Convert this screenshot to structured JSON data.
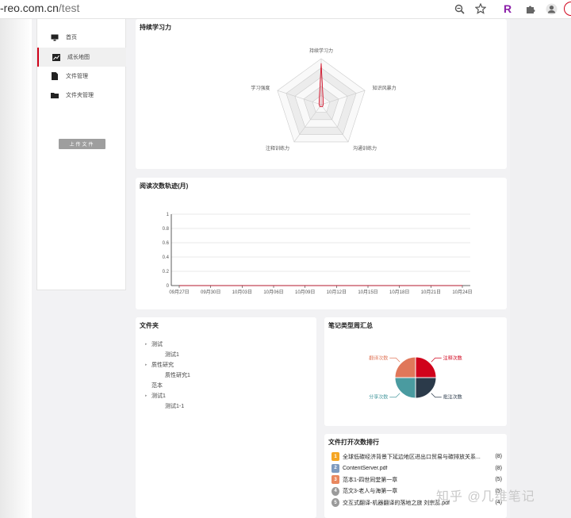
{
  "browser": {
    "url_prefix": "-reo.com.cn",
    "url_path": "/test"
  },
  "sidebar": {
    "items": [
      {
        "label": "首页",
        "icon": "monitor-icon",
        "active": false
      },
      {
        "label": "成长地图",
        "icon": "chart-icon",
        "active": true
      },
      {
        "label": "文件管理",
        "icon": "document-icon",
        "active": false
      },
      {
        "label": "文件夹管理",
        "icon": "folder-icon",
        "active": false
      }
    ],
    "upload_label": "上传文件"
  },
  "radar": {
    "title": "持续学习力",
    "chart_data": {
      "type": "radar",
      "axes": [
        "持续学习力",
        "知识风暴力",
        "沟通训练力",
        "注释训练力",
        "学习强度"
      ],
      "values": [
        0.9,
        0.05,
        0.05,
        0.05,
        0.05
      ],
      "levels": 5
    }
  },
  "reading": {
    "title": "阅读次数轨迹(月)",
    "chart_data": {
      "type": "line",
      "x": [
        "09月27日",
        "09月30日",
        "10月03日",
        "10月06日",
        "10月09日",
        "10月12日",
        "10月15日",
        "10月18日",
        "10月21日",
        "10月24日"
      ],
      "series": [
        {
          "values": [
            0,
            0,
            0,
            0,
            0,
            0,
            0,
            0,
            0,
            0
          ]
        }
      ],
      "yticks": [
        "0",
        "0.2",
        "0.4",
        "0.6",
        "0.8",
        "1"
      ],
      "ylim": [
        0,
        1
      ],
      "grid": true
    }
  },
  "folders": {
    "title": "文件夹",
    "items": [
      {
        "label": "测试",
        "level": 0,
        "caret": "▸"
      },
      {
        "label": "测试1",
        "level": 1,
        "caret": ""
      },
      {
        "label": "质性研究",
        "level": 0,
        "caret": "▸"
      },
      {
        "label": "质性研究1",
        "level": 1,
        "caret": ""
      },
      {
        "label": "范本",
        "level": 0,
        "caret": ""
      },
      {
        "label": "测试1",
        "level": 0,
        "caret": "▸"
      },
      {
        "label": "测试1-1",
        "level": 1,
        "caret": ""
      }
    ]
  },
  "notes": {
    "title": "笔记类型周汇总",
    "chart_data": {
      "type": "pie",
      "slices": [
        {
          "name": "注释次数",
          "value": 1,
          "color": "#d0021b"
        },
        {
          "name": "批注次数",
          "value": 1,
          "color": "#2b3a4a"
        },
        {
          "name": "分享次数",
          "value": 1,
          "color": "#4a9ba0"
        },
        {
          "name": "翻译次数",
          "value": 1,
          "color": "#e0775a"
        }
      ]
    }
  },
  "ranking": {
    "title": "文件打开次数排行",
    "rows": [
      {
        "badge": "1",
        "badge_color": "#f5a623",
        "name": "全球低碳经济背景下延边地区进出口贸易与碳排放关系...",
        "count": "(8)"
      },
      {
        "badge": "2",
        "badge_color": "#7f9bbf",
        "name": "ContentServer.pdf",
        "count": "(8)"
      },
      {
        "badge": "3",
        "badge_color": "#e9885f",
        "name": "范本1-四世同堂第一章",
        "count": "(5)"
      },
      {
        "badge": "4",
        "badge_color": "#9a9a9a",
        "name": "范文3-老人与海第一章",
        "count": "(5)"
      },
      {
        "badge": "5",
        "badge_color": "#9a9a9a",
        "name": "交互式翻译-机器翻译的落地之旅 刘宗蕊.pdf",
        "count": "(4)"
      }
    ]
  },
  "watermark": "知乎 @几维笔记"
}
